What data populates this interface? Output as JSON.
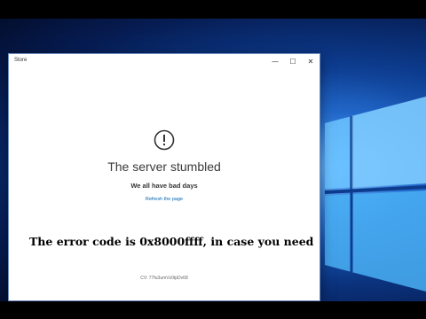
{
  "window": {
    "app_title": "Store",
    "controls": {
      "minimize_glyph": "—",
      "maximize_glyph": "☐",
      "close_glyph": "✕"
    }
  },
  "error": {
    "icon": "alert-circle-icon",
    "title": "The server stumbled",
    "subtitle": "We all have bad days",
    "refresh_link": "Refresh the page",
    "cv": "CV: 77fu3umVz0tpDv68"
  },
  "overlay": {
    "caption": "The error code is 0x8000ffff, in case you need"
  },
  "colors": {
    "link": "#0063b1",
    "desktop_accent": "#1f66c9",
    "window_bg": "#ffffff"
  }
}
